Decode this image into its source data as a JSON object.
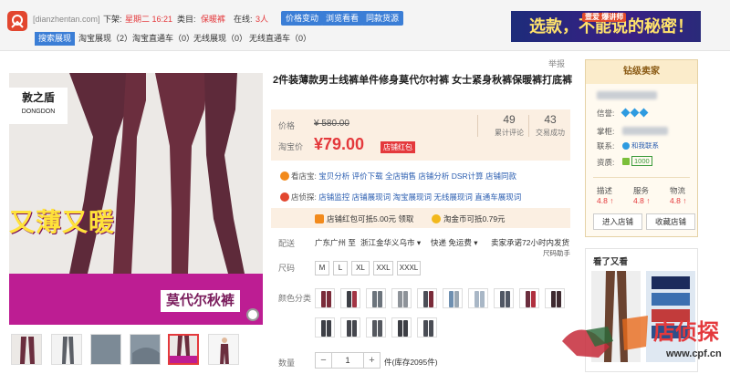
{
  "topbar": {
    "site": "[dianzhentan.com]",
    "time_label": "下架:",
    "time_value": "星期二 16:21",
    "category_label": "类目:",
    "category_value": "保暖裤",
    "online_label": "在线:",
    "online_value": "3人",
    "btn_price": "价格变动",
    "btn_rank": "浏览看看",
    "btn_source": "同款货源",
    "tabs": [
      "搜索展现",
      "淘宝展现（2）",
      "淘宝直通车（0）",
      "无线展现（0）",
      "无线直通车（0）"
    ],
    "ad_sub": "壹爱 爆讲师",
    "ad_text": "选款，不能说的秘密！"
  },
  "image": {
    "brand_cn": "敦之盾",
    "brand_en": "DONGDON",
    "promo_1": "又薄又暖",
    "promo_2": "莫代尔秋裤"
  },
  "product": {
    "report": "举报",
    "title": "2件装薄款男士线裤单件修身莫代尔衬裤 女士紧身秋裤保暖裤打底裤",
    "price_label": "价格",
    "orig_price": "¥ 580.00",
    "promo_label": "淘宝价",
    "price_now": "¥79.00",
    "coupon_tag": "店铺红包",
    "reviews_num": "49",
    "reviews_lbl": "累计评论",
    "sales_num": "43",
    "sales_lbl": "交易成功",
    "tool_row_1_label": "看店宝:",
    "tool_row_1": "宝贝分析  评价下载  全店销售  店铺分析  DSR计算  店铺同款",
    "tool_row_2_label": "店侦探:",
    "tool_row_2": "店铺监控  店铺展现词  淘宝展现词  无线展现词  直通车展现词",
    "coupon_1": "店铺红包可抵5.00元 领取",
    "coupon_2": "淘金币可抵0.79元",
    "delivery_label": "配送",
    "delivery_from": "广东广州 至",
    "delivery_to": "浙江金华义乌市",
    "delivery_fee": "快递 免运费",
    "delivery_promise": "卖家承诺72小时内发货",
    "delivery_helper": "尺码助手",
    "size_label": "尺码",
    "sizes": [
      "M",
      "L",
      "XL",
      "XXL",
      "XXXL"
    ],
    "color_label": "颜色分类",
    "qty_label": "数量",
    "qty_value": "1",
    "stock": "件(库存2095件)"
  },
  "seller": {
    "badge": "钻级卖家",
    "credit_label": "信誉:",
    "owner_label": "掌柜:",
    "contact_label": "联系:",
    "contact_value": "和我联系",
    "qual_label": "资质:",
    "qual_value": "1000",
    "scores": [
      {
        "label": "描述",
        "value": "4.8"
      },
      {
        "label": "服务",
        "value": "4.8"
      },
      {
        "label": "物流",
        "value": "4.8"
      }
    ],
    "btn_enter": "进入店铺",
    "btn_fav": "收藏店铺"
  },
  "also": {
    "title": "看了又看"
  },
  "watermark": {
    "brand": "店侦探",
    "url": "www.cpf.cn"
  },
  "colors": {
    "accent_red": "#e4393c",
    "blue": "#3b7ed6",
    "purple_band": "#bd1d93",
    "leg_color": "#6b2e3e"
  }
}
